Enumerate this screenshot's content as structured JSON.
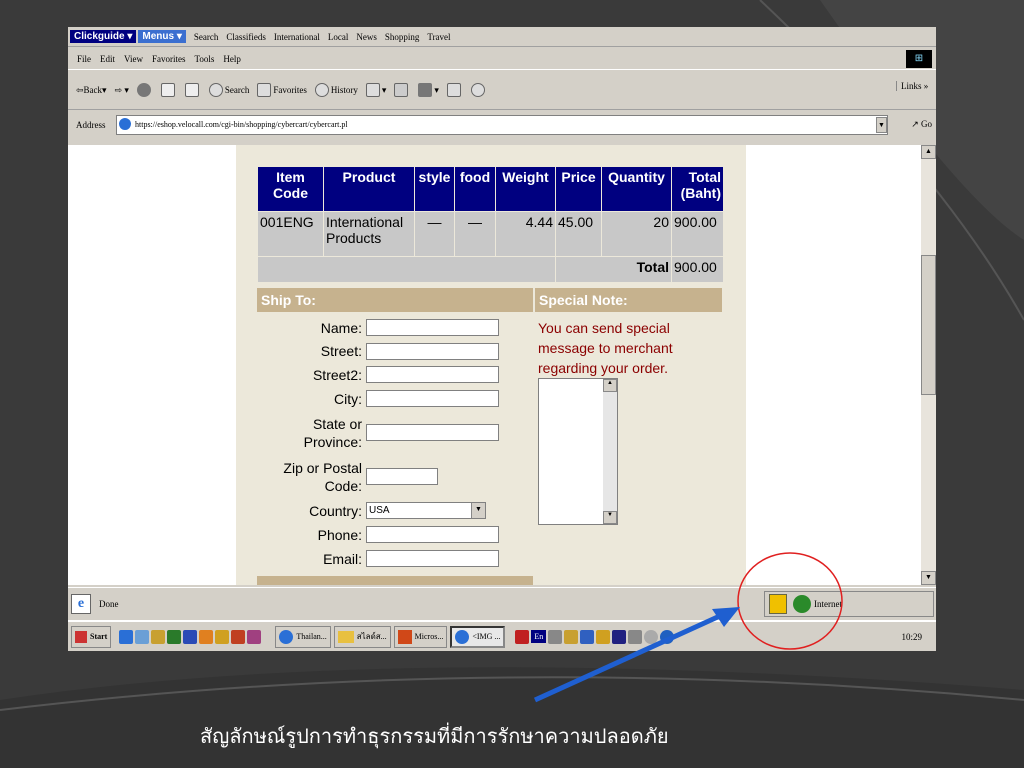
{
  "top_strip": {
    "clickguide": "Clickguide ▾",
    "menus": "Menus ▾",
    "links": [
      "Search",
      "Classifieds",
      "International",
      "Local",
      "News",
      "Shopping",
      "Travel"
    ]
  },
  "menu": [
    "File",
    "Edit",
    "View",
    "Favorites",
    "Tools",
    "Help"
  ],
  "toolbar": {
    "back": "Back",
    "search": "Search",
    "favorites": "Favorites",
    "history": "History",
    "links": "Links"
  },
  "address": {
    "label": "Address",
    "url": "https://eshop.velocall.com/cgi-bin/shopping/cybercart/cybercart.pl",
    "go": "Go"
  },
  "cart": {
    "headers": [
      "Item Code",
      "Product",
      "style",
      "food",
      "Weight",
      "Price",
      "Quantity",
      "Total (Baht)"
    ],
    "rows": [
      {
        "code": "001ENG",
        "product": "International Products",
        "style": "—",
        "food": "—",
        "weight": "4.44",
        "price": "45.00",
        "quantity": "20",
        "total": "900.00"
      }
    ],
    "total_label": "Total",
    "total_value": "900.00"
  },
  "ship": {
    "title": "Ship To:",
    "fields": {
      "name": "Name:",
      "street": "Street:",
      "street2": "Street2:",
      "city": "City:",
      "state": "State or Province:",
      "zip": "Zip or Postal Code:",
      "country": "Country:",
      "phone": "Phone:",
      "email": "Email:"
    },
    "country_value": "USA"
  },
  "note": {
    "title": "Special Note:",
    "text": "You can send special message to merchant regarding your order."
  },
  "status": {
    "text": "Done",
    "zone": "Internet"
  },
  "taskbar": {
    "start": "Start",
    "buttons": [
      "Thailan...",
      "สไลด์ส...",
      "Micros...",
      "<IMG ..."
    ],
    "lang": "En",
    "clock": "10:29"
  },
  "caption": "สัญลักษณ์รูปการทำธุรกรรมที่มีการรักษาความปลอดภัย",
  "colors": {
    "header_blue": "#000080",
    "section_tan": "#c6b28e",
    "note_red": "#8b0000",
    "arrow_blue": "#1f5fd0",
    "circle_red": "#e02020"
  }
}
